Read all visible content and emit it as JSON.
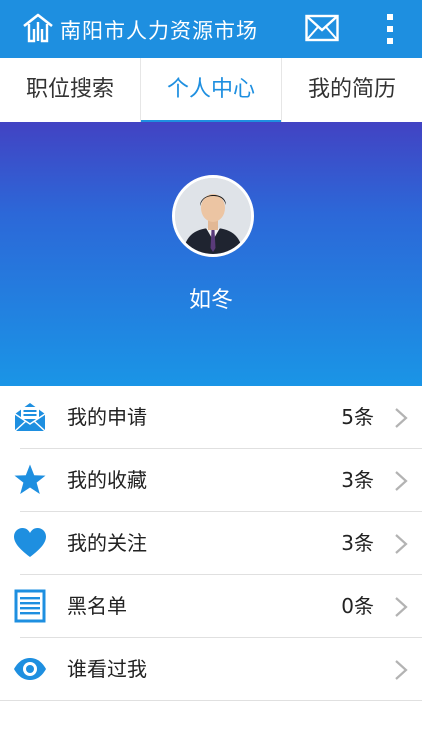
{
  "app": {
    "title": "南阳市人力资源市场",
    "logo_icon": "house-logo-icon",
    "mail_icon": "mail-icon",
    "more_icon": "more-vertical-icon",
    "accent": "#1e8fe0"
  },
  "tabs": [
    {
      "label": "职位搜索",
      "active": false
    },
    {
      "label": "个人中心",
      "active": true
    },
    {
      "label": "我的简历",
      "active": false
    }
  ],
  "profile": {
    "name": "如冬",
    "avatar_icon": "avatar-photo"
  },
  "menu": [
    {
      "label": "我的申请",
      "count": "5条",
      "icon": "envelope-message-icon"
    },
    {
      "label": "我的收藏",
      "count": "3条",
      "icon": "star-icon"
    },
    {
      "label": "我的关注",
      "count": "3条",
      "icon": "heart-icon"
    },
    {
      "label": "黑名单",
      "count": "0条",
      "icon": "list-icon"
    },
    {
      "label": "谁看过我",
      "count": "",
      "icon": "eye-icon"
    }
  ]
}
